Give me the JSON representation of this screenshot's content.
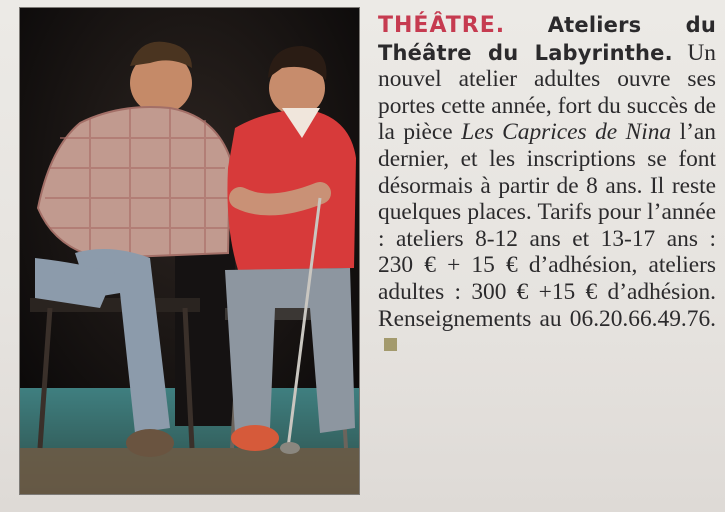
{
  "article": {
    "kicker": "THÉÂTRE.",
    "headline": "Ateliers du Théâtre du Labyrinthe.",
    "body_before_title": "Un nouvel atelier adultes ouvre ses portes cette année, fort du succès de la pièce",
    "play_title": "Les Caprices de Nina",
    "body_after_title": "l’an dernier, et les inscriptions se font désormais à partir de 8 ans. Il reste quelques places. Tarifs pour l’année : ateliers 8-12 ans et 13-17 ans : 230 € + 15 € d’adhésion, ateliers adultes : 300 € +15 € d’adhésion. Renseignements au 06.20.66.49.76."
  },
  "colors": {
    "kicker": "#c63b50",
    "end_square": "#a39a6d"
  }
}
